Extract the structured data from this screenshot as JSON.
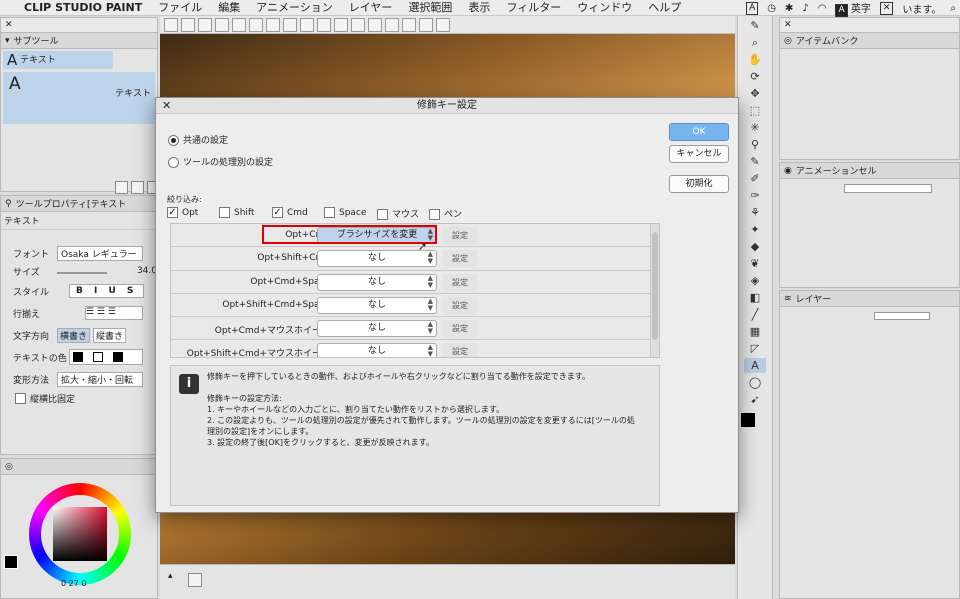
{
  "menubar": {
    "apple": "",
    "app": "CLIP STUDIO PAINT",
    "items": [
      "ファイル",
      "編集",
      "アニメーション",
      "レイヤー",
      "選択範囲",
      "表示",
      "フィルター",
      "ウィンドウ",
      "ヘルプ"
    ],
    "status": {
      "ime_mode": "A",
      "ime_label": "英字",
      "user": "います。"
    }
  },
  "left_panel": {
    "subtool_tab": "サブツール",
    "subtool_item1": "テキスト",
    "subtool_item2": "テキスト",
    "toolprop_tab": "ツールプロパティ[テキスト",
    "toolprop_title": "テキスト",
    "props": [
      {
        "label": "フォント",
        "value": "Osaka レギュラー"
      },
      {
        "label": "サイズ",
        "value": "34.0"
      },
      {
        "label": "スタイル",
        "value": "B I U S"
      },
      {
        "label": "行揃え",
        "value": ""
      },
      {
        "label": "文字方向",
        "value": "横書き",
        "value2": "縦書き"
      },
      {
        "label": "テキストの色",
        "value": ""
      },
      {
        "label": "変形方法",
        "value": "拡大・縮小・回転"
      }
    ],
    "keep_ratio": "縦横比固定",
    "color_readout": "0  27  0"
  },
  "right_panels": {
    "item_bank_tab": "アイテムバンク",
    "anim_tab": "アニメーションセル",
    "layer_tab": "レイヤー"
  },
  "dialog": {
    "title": "修飾キー設定",
    "radio_common": "共通の設定",
    "radio_per_tool": "ツールの処理別の設定",
    "ok": "OK",
    "cancel": "キャンセル",
    "reset": "初期化",
    "filter_label": "絞り込み:",
    "filters": [
      {
        "label": "Opt",
        "checked": true
      },
      {
        "label": "Shift",
        "checked": false
      },
      {
        "label": "Cmd",
        "checked": true
      },
      {
        "label": "Space",
        "checked": false
      },
      {
        "label": "マウス",
        "checked": false
      },
      {
        "label": "ペン",
        "checked": false
      }
    ],
    "rows": [
      {
        "label": "Opt+Cmd:",
        "value": "ブラシサイズを変更",
        "button": "設定"
      },
      {
        "label": "Opt+Shift+Cmd:",
        "value": "なし",
        "button": "設定"
      },
      {
        "label": "Opt+Cmd+Space:",
        "value": "なし",
        "button": "設定"
      },
      {
        "label": "Opt+Shift+Cmd+Space:",
        "value": "なし",
        "button": "設定"
      },
      {
        "label": "Opt+Cmd+マウスホイール:",
        "value": "なし",
        "button": "設定"
      },
      {
        "label": "Opt+Shift+Cmd+マウスホイール:",
        "value": "なし",
        "button": "設定"
      }
    ],
    "info_lines": [
      "修飾キーを押下しているときの動作、およびホイールや右クリックなどに割り当てる動作を設定できます。",
      "",
      "修飾キーの設定方法:",
      "1. キーやホイールなどの入力ごとに、割り当てたい動作をリストから選択します。",
      "2. この設定よりも、ツールの処理別の設定が優先されて動作します。ツールの処理別の設定を変更するには[ツールの処",
      "理別の設定]をオンにします。",
      "3. 設定の終了後[OK]をクリックすると、変更が反映されます。"
    ]
  },
  "colors": {
    "accent": "#79b4f1",
    "highlight": "#e00000",
    "selected": "#bfd3ec"
  }
}
